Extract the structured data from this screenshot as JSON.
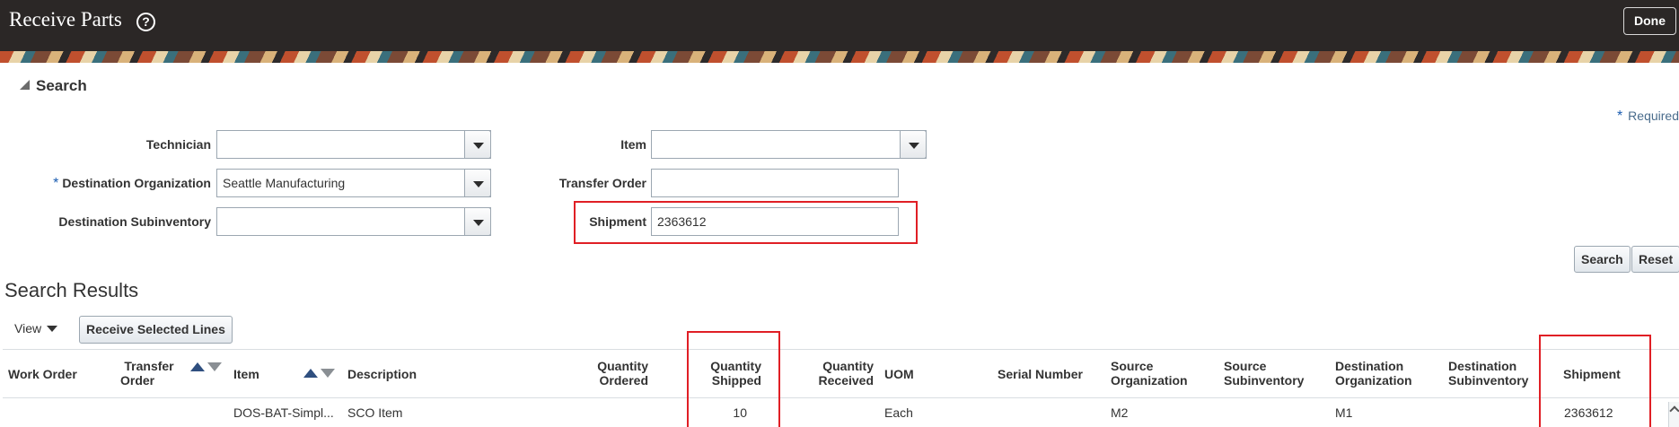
{
  "header": {
    "title": "Receive Parts",
    "help_icon": "question-circle-icon",
    "done_label": "Done"
  },
  "search": {
    "section_title": "Search",
    "required_note": "Required",
    "required_marker": "*",
    "fields": {
      "technician": {
        "label": "Technician",
        "value": ""
      },
      "destination_organization": {
        "label": "Destination Organization",
        "value": "Seattle Manufacturing"
      },
      "destination_subinventory": {
        "label": "Destination Subinventory",
        "value": ""
      },
      "item": {
        "label": "Item",
        "value": ""
      },
      "transfer_order": {
        "label": "Transfer Order",
        "value": ""
      },
      "shipment": {
        "label": "Shipment",
        "value": "2363612"
      }
    },
    "search_button": "Search",
    "reset_button": "Reset"
  },
  "results": {
    "title": "Search Results",
    "view_menu": "View",
    "receive_button": "Receive Selected Lines",
    "columns": {
      "work_order": "Work Order",
      "transfer_order_1": "Transfer",
      "transfer_order_2": "Order",
      "item": "Item",
      "description": "Description",
      "qty_ordered_1": "Quantity",
      "qty_ordered_2": "Ordered",
      "qty_shipped_1": "Quantity",
      "qty_shipped_2": "Shipped",
      "qty_received_1": "Quantity",
      "qty_received_2": "Received",
      "uom": "UOM",
      "serial_number": "Serial Number",
      "source_org_1": "Source",
      "source_org_2": "Organization",
      "source_sub_1": "Source",
      "source_sub_2": "Subinventory",
      "dest_org_1": "Destination",
      "dest_org_2": "Organization",
      "dest_sub_1": "Destination",
      "dest_sub_2": "Subinventory",
      "shipment": "Shipment"
    },
    "rows": [
      {
        "work_order": "",
        "transfer_order": "",
        "item": "DOS-BAT-Simpl...",
        "description": "SCO Item",
        "quantity_ordered": "",
        "quantity_shipped": "10",
        "quantity_received": "",
        "uom": "Each",
        "serial_number": "",
        "source_organization": "M2",
        "source_subinventory": "",
        "destination_organization": "M1",
        "destination_subinventory": "",
        "shipment": "2363612"
      }
    ]
  },
  "colors": {
    "header_bg": "#2b2726",
    "highlight": "#e01f25",
    "required_star": "#1a5cb0"
  }
}
